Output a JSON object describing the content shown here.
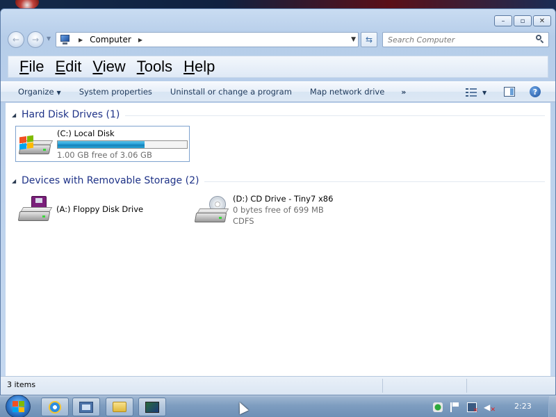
{
  "window": {
    "caption_buttons": [
      "minimize-icon",
      "maximize-icon",
      "close-icon"
    ]
  },
  "address_bar": {
    "location_icon": "computer-icon",
    "breadcrumb": "Computer"
  },
  "search": {
    "placeholder": "Search Computer"
  },
  "menu": {
    "file": "File",
    "edit": "Edit",
    "view": "View",
    "tools": "Tools",
    "help": "Help"
  },
  "command_bar": {
    "organize": "Organize",
    "system_properties": "System properties",
    "uninstall": "Uninstall or change a program",
    "map_drive": "Map network drive",
    "more": "»"
  },
  "groups": [
    {
      "title": "Hard Disk Drives (1)",
      "items": [
        {
          "name": "(C:) Local Disk",
          "free_text": "1.00 GB free of 3.06 GB",
          "used_fraction": 0.67,
          "icon": "hard-disk-icon",
          "selected": true
        }
      ]
    },
    {
      "title": "Devices with Removable Storage (2)",
      "items": [
        {
          "name": "(A:) Floppy Disk Drive",
          "icon": "floppy-drive-icon"
        },
        {
          "name": "(D:) CD Drive - Tiny7 x86",
          "free_text": "0 bytes free of 699 MB",
          "filesystem": "CDFS",
          "icon": "cd-drive-icon"
        }
      ]
    }
  ],
  "status_bar": {
    "items_count": "3 items"
  },
  "taskbar": {
    "pinned": [
      "internet-explorer-icon",
      "device-manager-icon",
      "windows-explorer-icon",
      "remote-desktop-icon"
    ],
    "clock": "2:23"
  },
  "colors": {
    "group_title": "#1e3287",
    "usage_fill": "#26a0da",
    "taskbar": "#7e9dc0"
  }
}
